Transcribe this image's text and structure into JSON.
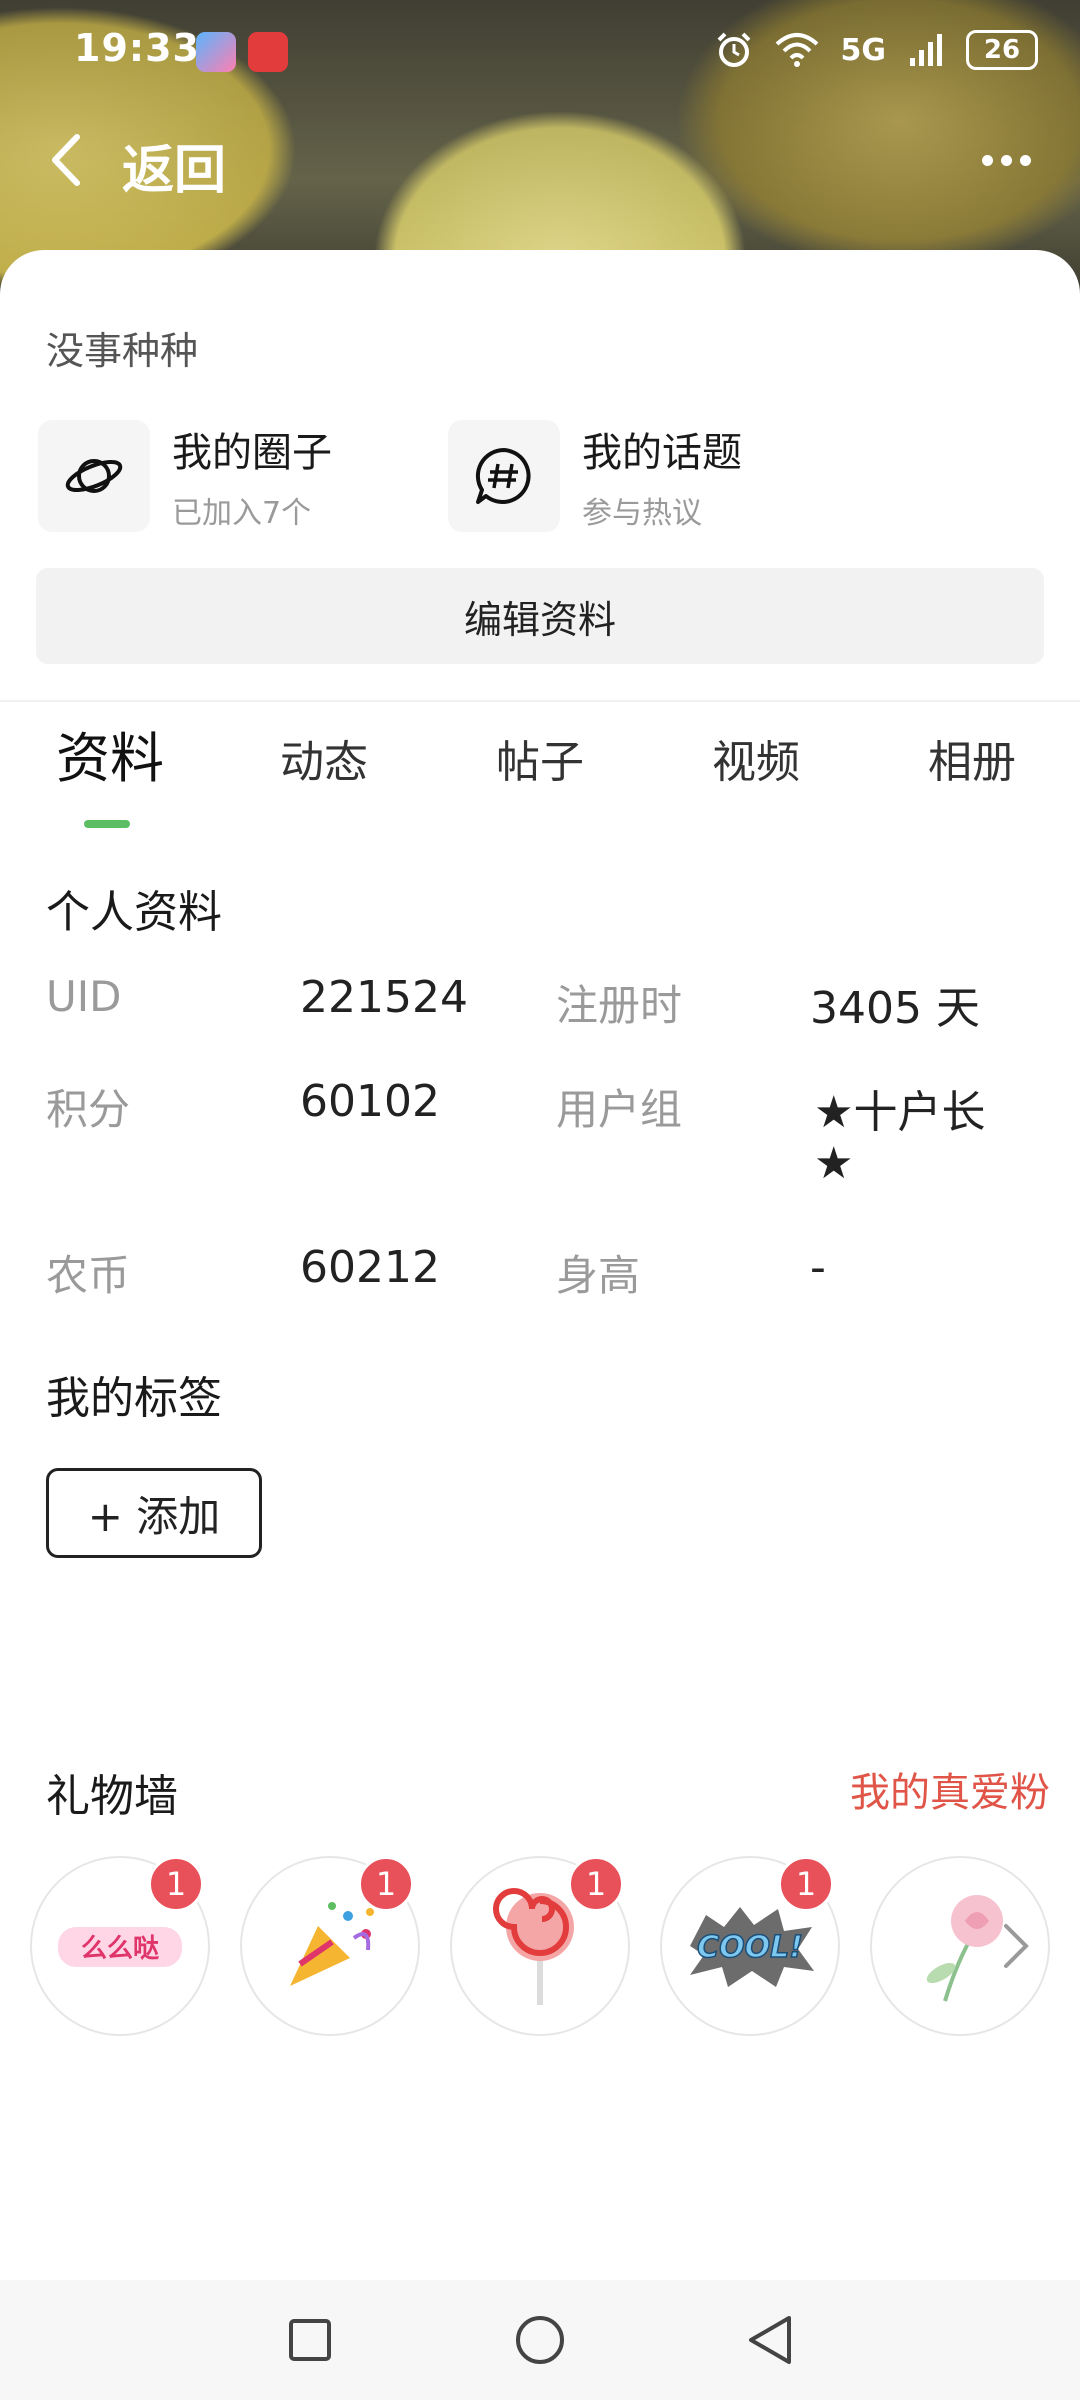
{
  "status": {
    "time": "19:33",
    "network": "5G",
    "battery": "26"
  },
  "topbar": {
    "back_label": "返回"
  },
  "profile": {
    "bio": "没事种种",
    "circles": {
      "title": "我的圈子",
      "subtitle": "已加入7个"
    },
    "topics": {
      "title": "我的话题",
      "subtitle": "参与热议"
    },
    "edit_label": "编辑资料"
  },
  "tabs": [
    "资料",
    "动态",
    "帖子",
    "视频",
    "相册"
  ],
  "active_tab": "资料",
  "info": {
    "section_title": "个人资料",
    "rows": [
      {
        "label1": "UID",
        "value1": "221524",
        "label2": "注册时",
        "value2": "3405 天"
      },
      {
        "label1": "积分",
        "value1": "60102",
        "label2": "用户组",
        "value2": "★十户长",
        "value2b": "★"
      },
      {
        "label1": "农币",
        "value1": "60212",
        "label2": "身高",
        "value2": "-"
      }
    ]
  },
  "tags": {
    "section_title": "我的标签",
    "add_label": "+ 添加"
  },
  "gifts": {
    "section_title": "礼物墙",
    "fans_link": "我的真爱粉",
    "items": [
      {
        "name": "么么哒",
        "count": "1"
      },
      {
        "name": "confetti",
        "count": "1"
      },
      {
        "name": "lollipop",
        "count": "1"
      },
      {
        "name": "COOL!",
        "count": "1"
      },
      {
        "name": "rose",
        "count": ""
      }
    ]
  },
  "colors": {
    "accent_green": "#5cbd63",
    "fans_red": "#e05548",
    "badge_red": "#e8515a"
  }
}
